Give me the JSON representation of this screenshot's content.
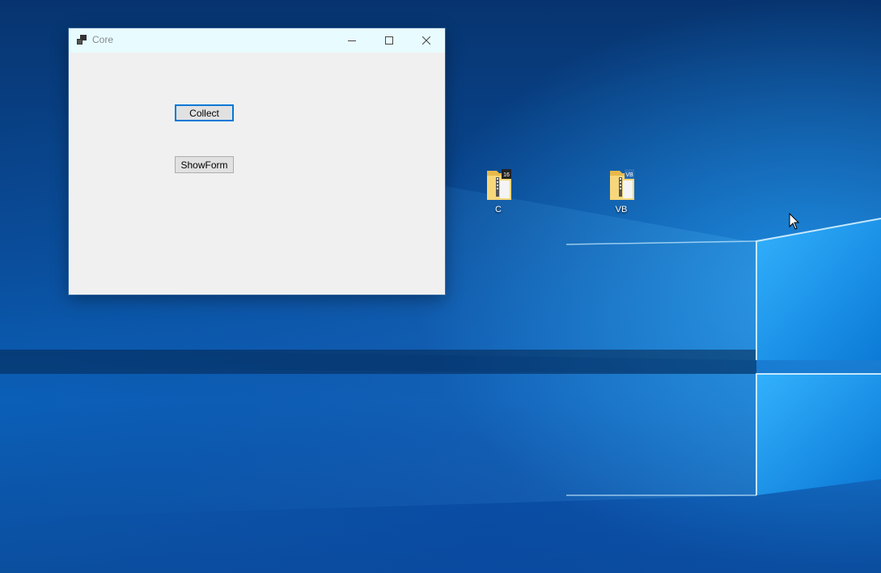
{
  "window": {
    "title": "Core",
    "controls": {
      "minimize": "minimize-icon",
      "maximize": "maximize-icon",
      "close": "close-icon"
    },
    "buttons": {
      "collect": "Collect",
      "show_form": "ShowForm"
    }
  },
  "desktop": {
    "icons": [
      {
        "label": "C",
        "badge": "16",
        "icon": "folder-zip-icon"
      },
      {
        "label": "VB",
        "badge": "VB",
        "icon": "folder-zip-icon"
      }
    ]
  },
  "colors": {
    "title_bar": "#e8fbff",
    "window_bg": "#f0f0f0",
    "focus_border": "#0078d7",
    "desktop_blue": "#0b5fb7"
  }
}
